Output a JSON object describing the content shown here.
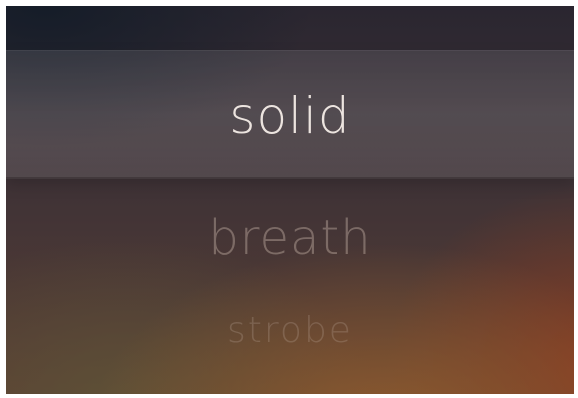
{
  "picker": {
    "options": [
      {
        "label": "solid",
        "selected": true
      },
      {
        "label": "breath",
        "selected": false
      },
      {
        "label": "strobe",
        "selected": false
      }
    ]
  }
}
